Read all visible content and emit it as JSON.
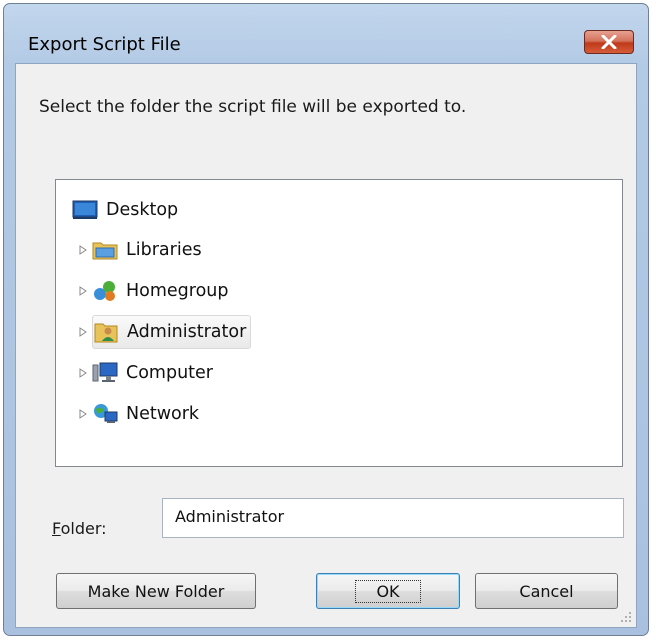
{
  "window": {
    "title": "Export Script File",
    "close_label": "×"
  },
  "instruction": "Select the folder the script file will be exported to.",
  "tree": {
    "items": [
      {
        "label": "Desktop",
        "icon": "desktop-icon",
        "expandable": false
      },
      {
        "label": "Libraries",
        "icon": "libraries-icon",
        "expandable": true
      },
      {
        "label": "Homegroup",
        "icon": "homegroup-icon",
        "expandable": true
      },
      {
        "label": "Administrator",
        "icon": "user-folder-icon",
        "expandable": true,
        "selected": true
      },
      {
        "label": "Computer",
        "icon": "computer-icon",
        "expandable": true
      },
      {
        "label": "Network",
        "icon": "network-icon",
        "expandable": true
      }
    ]
  },
  "folder": {
    "label": "Folder:",
    "value": "Administrator"
  },
  "buttons": {
    "make_new_folder": "Make New Folder",
    "ok": "OK",
    "cancel": "Cancel"
  },
  "colors": {
    "frame": "#b3cae6",
    "close_button": "#c0391b",
    "client": "#f0f0f0"
  }
}
